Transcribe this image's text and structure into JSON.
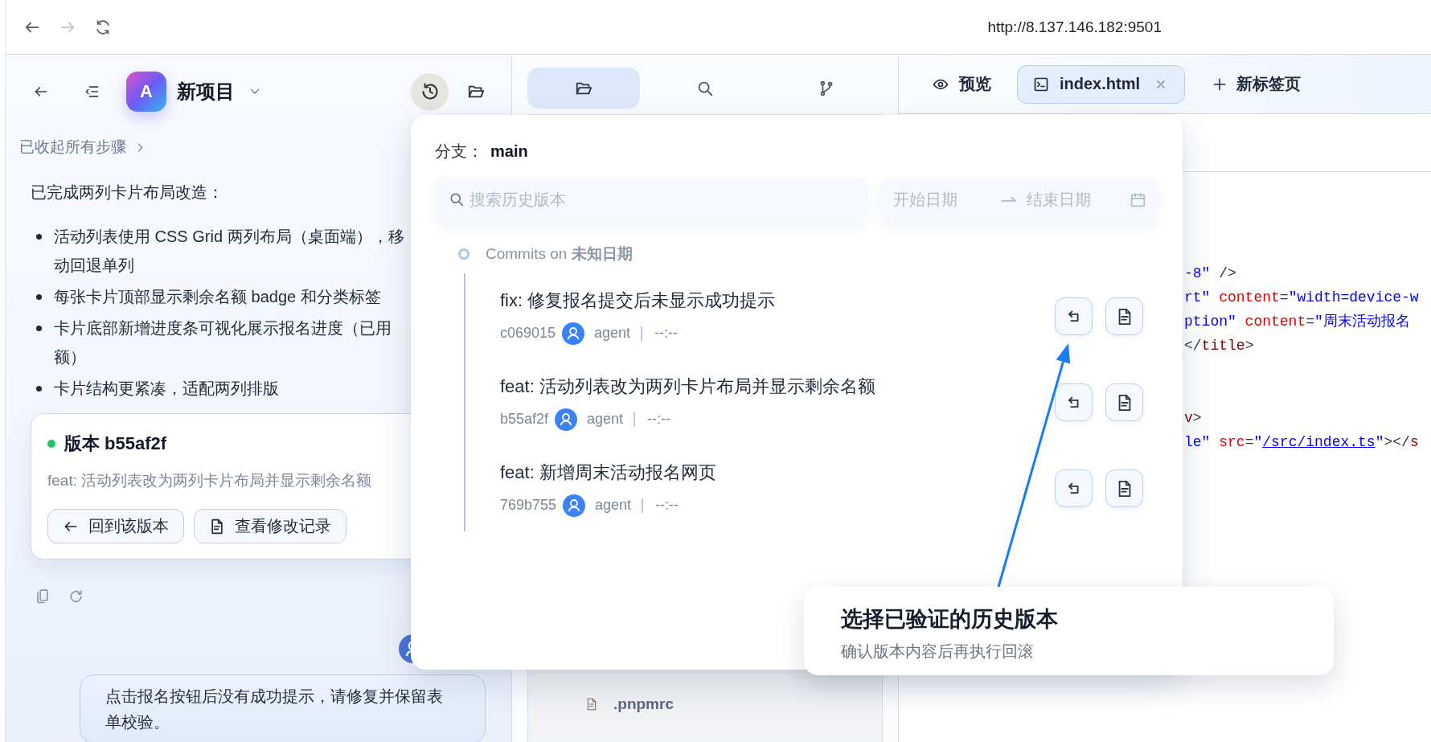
{
  "browser": {
    "nav": [
      {
        "kind": "back",
        "disabled": false
      },
      {
        "kind": "forward",
        "disabled": true
      },
      {
        "kind": "reload",
        "disabled": false
      }
    ],
    "url": "http://8.137.146.182:9501"
  },
  "project_header": {
    "avatar_letter": "A",
    "name": "新项目",
    "history_active": true
  },
  "chat": {
    "collapsed_steps": "已收起所有步骤",
    "summary": "已完成两列卡片布局改造：",
    "bullets": [
      {
        "lines": [
          "活动列表使用 CSS Grid 两列布局（桌面端），移",
          "动回退单列"
        ]
      },
      {
        "lines": [
          "每张卡片顶部显示剩余名额 badge 和分类标签"
        ]
      },
      {
        "lines": [
          "卡片底部新增进度条可视化展示报名进度（已用",
          "额）"
        ]
      },
      {
        "lines": [
          "卡片结构更紧凑，适配两列排版"
        ]
      }
    ],
    "version_card": {
      "color": "#22c55e",
      "title": "版本 b55af2f",
      "message": "feat: 活动列表改为两列卡片布局并显示剩余名额",
      "buttons": [
        {
          "kind": "revert",
          "label": "回到该版本"
        },
        {
          "kind": "changes",
          "label": "查看修改记录"
        }
      ]
    },
    "user_message": "点击报名按钮后没有成功提示，请修复并保留表单校验。"
  },
  "file_panel": {
    "tabs": [
      {
        "kind": "files",
        "selected": true
      },
      {
        "kind": "search",
        "selected": false
      },
      {
        "kind": "branches",
        "selected": false
      }
    ],
    "files": [
      {
        "name": ".pnpmrc"
      }
    ]
  },
  "editor": {
    "tabs": [
      {
        "kind": "preview",
        "label": "预览",
        "selected": false
      },
      {
        "kind": "file",
        "label": "index.html",
        "selected": true
      }
    ],
    "new_tab_label": "新标签页",
    "code_blocks": [
      {
        "lines": [
          {
            "tokens": [
              {
                "kind": "string",
                "text": "-8\""
              },
              {
                "kind": "punct",
                "text": " />"
              }
            ]
          },
          {
            "tokens": [
              {
                "kind": "string",
                "text": "rt\""
              },
              {
                "kind": "attr",
                "text": " content"
              },
              {
                "kind": "punct",
                "text": "="
              },
              {
                "kind": "string",
                "text": "\"width=device-w"
              }
            ]
          },
          {
            "tokens": [
              {
                "kind": "string",
                "text": "ption\""
              },
              {
                "kind": "attr",
                "text": " content"
              },
              {
                "kind": "punct",
                "text": "="
              },
              {
                "kind": "string",
                "text": "\"周末活动报名"
              }
            ]
          },
          {
            "tokens": [
              {
                "kind": "punct",
                "text": "</"
              },
              {
                "kind": "tag",
                "text": "title"
              },
              {
                "kind": "punct",
                "text": ">"
              }
            ]
          }
        ]
      },
      {
        "lines": [
          {
            "tokens": [
              {
                "kind": "tag",
                "text": "v"
              },
              {
                "kind": "punct",
                "text": ">"
              }
            ]
          },
          {
            "tokens": [
              {
                "kind": "string",
                "text": "le\""
              },
              {
                "kind": "attr",
                "text": " src"
              },
              {
                "kind": "punct",
                "text": "="
              },
              {
                "kind": "string",
                "text": "\""
              },
              {
                "kind": "link",
                "text": "/src/index.ts"
              },
              {
                "kind": "string",
                "text": "\""
              },
              {
                "kind": "punct",
                "text": "></"
              },
              {
                "kind": "tag",
                "text": "s"
              }
            ]
          }
        ]
      }
    ]
  },
  "history_popup": {
    "branch_label": "分支：",
    "branch": "main",
    "search_placeholder": "搜索历史版本",
    "start_placeholder": "开始日期",
    "end_placeholder": "结束日期",
    "group_title": "Commits on **未知日期**",
    "commits": [
      {
        "message": "fix: 修复报名提交后未显示成功提示",
        "hash": "c069015",
        "author": "agent",
        "time": "--:--"
      },
      {
        "message": "feat: 活动列表改为两列卡片布局并显示剩余名额",
        "hash": "b55af2f",
        "author": "agent",
        "time": "--:--"
      },
      {
        "message": "feat: 新增周末活动报名网页",
        "hash": "769b755",
        "author": "agent",
        "time": "--:--"
      }
    ]
  },
  "callout": {
    "title": "选择已验证的历史版本",
    "subtitle": "确认版本内容后再执行回滚"
  }
}
